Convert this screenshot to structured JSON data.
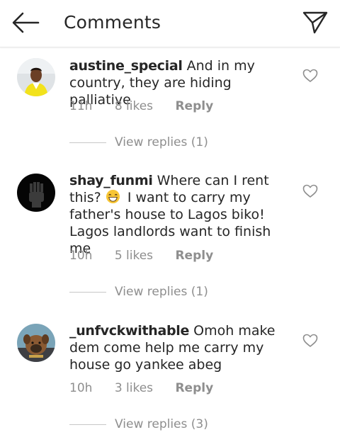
{
  "header": {
    "title": "Comments",
    "back_icon": "back-arrow-icon",
    "send_icon": "paper-plane-icon"
  },
  "colors": {
    "text": "#262626",
    "secondary": "#8e8e8e",
    "divider": "#e6e6e6"
  },
  "comments": [
    {
      "username": "austine_special",
      "text": "And in my country, they are hiding palliative",
      "time": "11h",
      "likes": "8 likes",
      "reply": "Reply",
      "view_replies": "View replies (1)"
    },
    {
      "username": "shay_funmi",
      "text_before_emoji": "Where can I rent this?",
      "emoji": "grinning-face-emoji",
      "text_after_emoji": "I want to carry my father's house to Lagos biko! Lagos landlords want to finish me",
      "time": "10h",
      "likes": "5 likes",
      "reply": "Reply",
      "view_replies": "View replies (1)"
    },
    {
      "username": "_unfvckwithable",
      "text": "Omoh make dem come help me carry my house go yankee abeg",
      "time": "10h",
      "likes": "3 likes",
      "reply": "Reply",
      "view_replies": "View replies (3)"
    }
  ]
}
